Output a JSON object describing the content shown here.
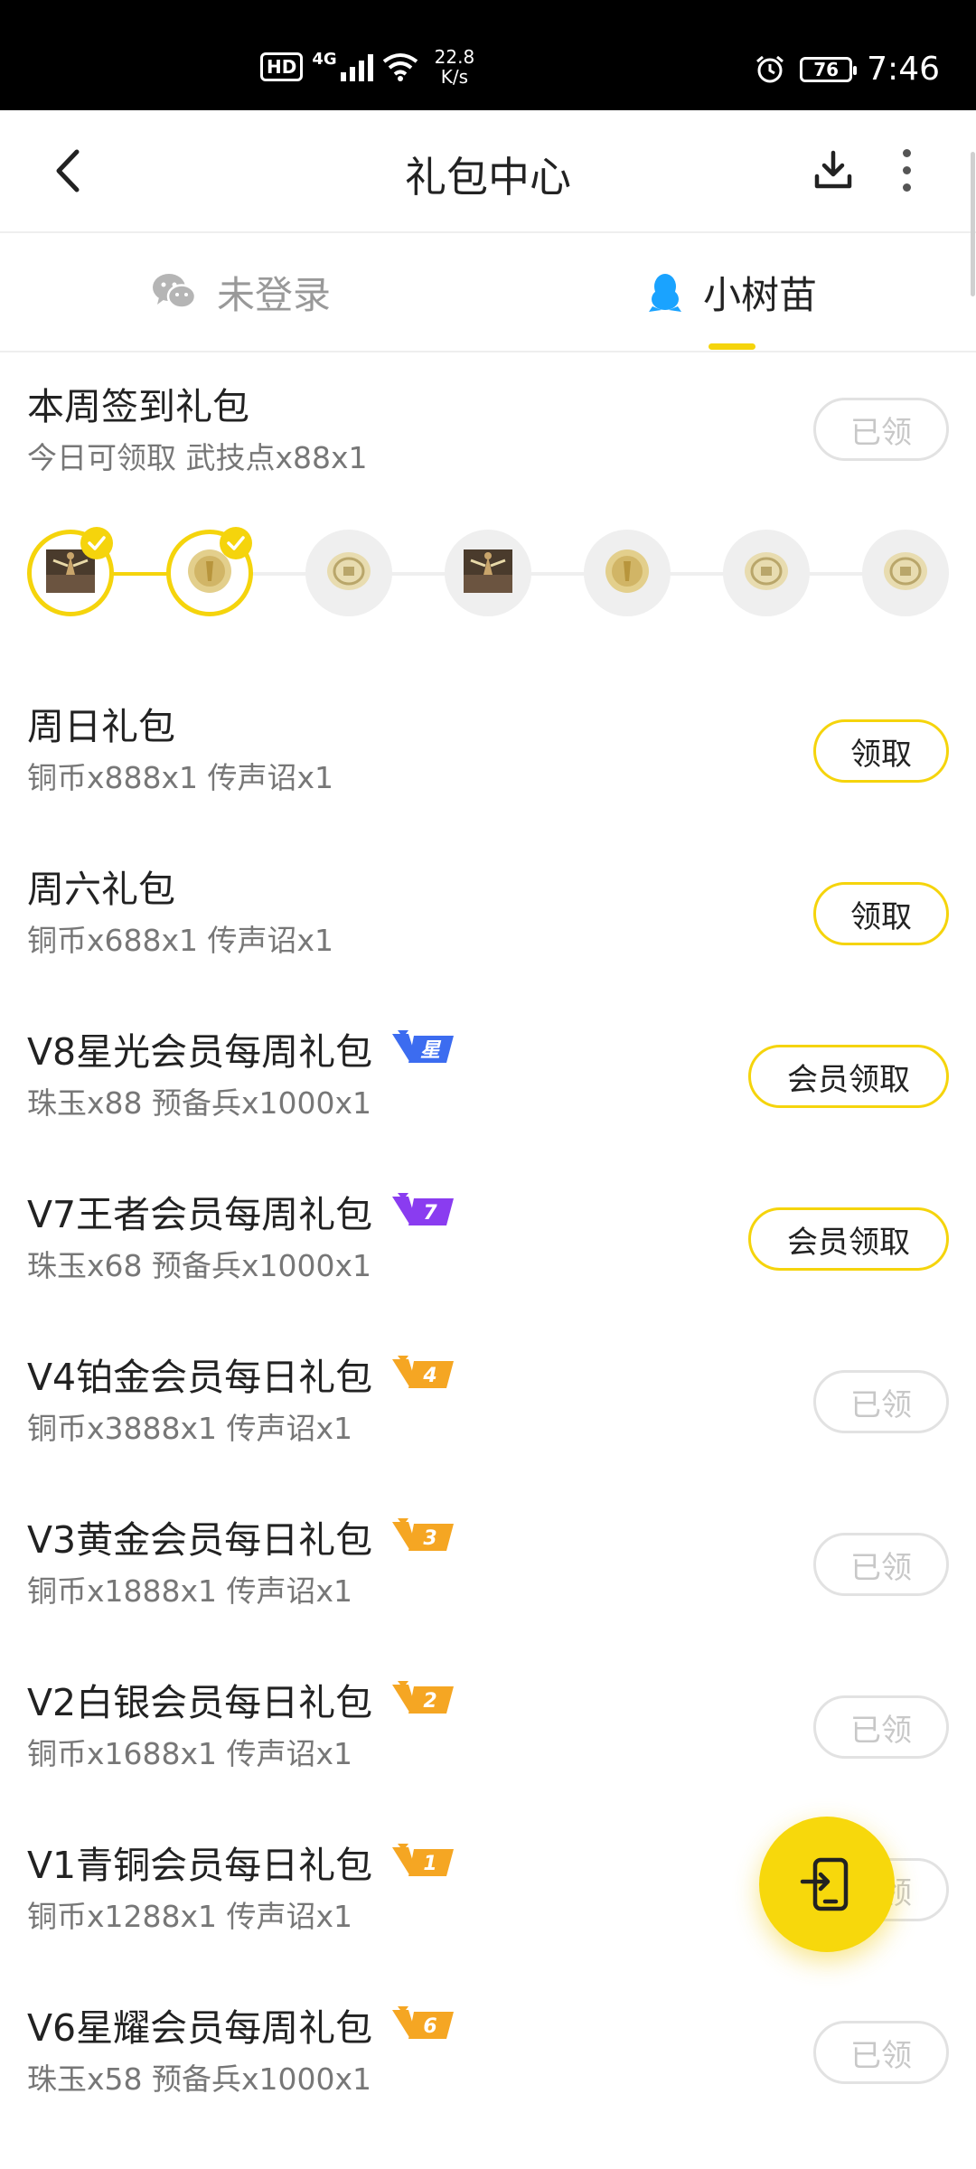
{
  "status_bar": {
    "hd": "HD",
    "network": "4G",
    "speed_value": "22.8",
    "speed_unit": "K/s",
    "battery": "76",
    "time": "7:46"
  },
  "header": {
    "title": "礼包中心"
  },
  "accounts": {
    "left_label": "未登录",
    "right_label": "小树苗"
  },
  "weekly_signin": {
    "title": "本周签到礼包",
    "subtitle": "今日可领取 武技点x88x1",
    "button": "已领",
    "days": [
      {
        "item": "warrior-item",
        "done": true
      },
      {
        "item": "gold-figure-item",
        "done": true
      },
      {
        "item": "coin-item",
        "done": false
      },
      {
        "item": "warrior-item",
        "done": false
      },
      {
        "item": "gold-figure-item",
        "done": false
      },
      {
        "item": "coin-item",
        "done": false
      },
      {
        "item": "coin-item",
        "done": false
      }
    ]
  },
  "gifts": [
    {
      "title": "周日礼包",
      "subtitle": "铜币x888x1 传声诏x1",
      "button": "领取",
      "state": "active",
      "badge": null
    },
    {
      "title": "周六礼包",
      "subtitle": "铜币x688x1 传声诏x1",
      "button": "领取",
      "state": "active",
      "badge": null
    },
    {
      "title": "V8星光会员每周礼包",
      "subtitle": "珠玉x88 预备兵x1000x1",
      "button": "会员领取",
      "state": "active",
      "badge": "星"
    },
    {
      "title": "V7王者会员每周礼包",
      "subtitle": "珠玉x68 预备兵x1000x1",
      "button": "会员领取",
      "state": "active",
      "badge": "7"
    },
    {
      "title": "V4铂金会员每日礼包",
      "subtitle": "铜币x3888x1 传声诏x1",
      "button": "已领",
      "state": "done",
      "badge": "4"
    },
    {
      "title": "V3黄金会员每日礼包",
      "subtitle": "铜币x1888x1 传声诏x1",
      "button": "已领",
      "state": "done",
      "badge": "3"
    },
    {
      "title": "V2白银会员每日礼包",
      "subtitle": "铜币x1688x1 传声诏x1",
      "button": "已领",
      "state": "done",
      "badge": "2"
    },
    {
      "title": "V1青铜会员每日礼包",
      "subtitle": "铜币x1288x1 传声诏x1",
      "button": "已领",
      "state": "done",
      "badge": "1"
    },
    {
      "title": "V6星耀会员每周礼包",
      "subtitle": "珠玉x58 预备兵x1000x1",
      "button": "已领",
      "state": "done",
      "badge": "6"
    }
  ],
  "colors": {
    "accent": "#f5d40c",
    "badge_orange": "#f5a623",
    "badge_purple": "#8a3cf0",
    "badge_blue": "#3c6cf0",
    "qq_blue": "#1aa3ff",
    "wechat_gray": "#b5b5b5"
  }
}
